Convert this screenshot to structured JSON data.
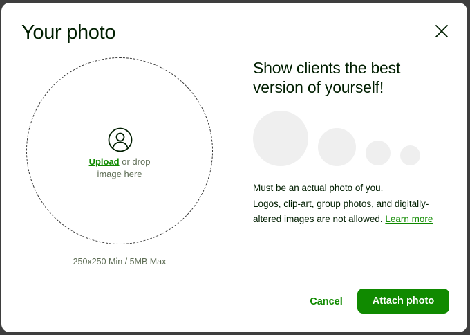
{
  "modal": {
    "title": "Your photo",
    "close_icon": "close-icon"
  },
  "upload": {
    "icon": "user-circle-icon",
    "link_label": "Upload",
    "drop_text_1": " or drop",
    "drop_text_2": "image here",
    "size_hint": "250x250 Min / 5MB Max"
  },
  "info": {
    "headline": "Show clients the best version of yourself!",
    "requirement_title": "Must be an actual photo of you.",
    "requirement_body": "Logos, clip-art, group photos, and digitally-altered images are not allowed. ",
    "learn_more_label": "Learn more"
  },
  "actions": {
    "cancel_label": "Cancel",
    "attach_label": "Attach photo"
  },
  "colors": {
    "accent": "#108a00",
    "text": "#001e00",
    "muted": "#5e6d55",
    "preview_circle": "#efefef"
  }
}
